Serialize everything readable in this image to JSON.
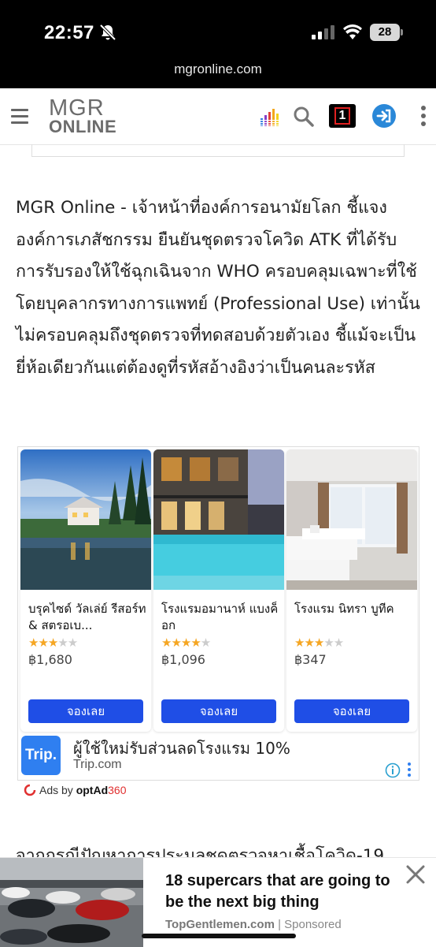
{
  "status_bar": {
    "time": "22:57",
    "battery": "28",
    "url": "mgronline.com"
  },
  "header": {
    "logo_line1": "MGR",
    "logo_line2": "ONLINE",
    "notification_badge": "1"
  },
  "article": {
    "paragraph1": "MGR Online - เจ้าหน้าที่องค์การอนามัยโลก ชี้แจงองค์การเภสัชกรรม ยืนยันชุดตรวจโควิด ATK ที่ได้รับการรับรองให้ใช้ฉุกเฉินจาก WHO ครอบคลุมเฉพาะที่ใช้โดยบุคลากรทางการแพทย์ (Professional Use) เท่านั้น ไม่ครอบคลุมถึงชุดตรวจที่ทดสอบด้วยตัวเอง ชี้แม้จะเป็นยี่ห้อเดียวกันแต่ต้องดูที่รหัสอ้างอิงว่าเป็นคนละรหัส",
    "paragraph2": "จากกรณีปัญหาการประมูลชุดตรวจหาเชื้อโควิด-19"
  },
  "hotel_ad": {
    "hotels": [
      {
        "name": "บรุคไซด์ วัลเล่ย์ รีสอร์ท & สตรอเบ...",
        "stars": 3,
        "price": "฿1,680",
        "button": "จองเลย"
      },
      {
        "name": "โรงแรมอมานาห์ แบงค็อก",
        "stars": 4,
        "price": "฿1,096",
        "button": "จองเลย"
      },
      {
        "name": "โรงแรม นิทรา บูทีค",
        "stars": 3,
        "price": "฿347",
        "button": "จองเลย"
      }
    ],
    "trip_logo": "Trip.",
    "trip_title": "ผู้ใช้ใหม่รับส่วนลดโรงแรม 10%",
    "trip_domain": "Trip.com",
    "ads_by_prefix": "Ads by ",
    "ads_by_brand": "optAd",
    "ads_by_num": "360"
  },
  "bottom_ad": {
    "title": "18 supercars that are going to be the next big thing",
    "source": "TopGentlemen.com",
    "separator": " | ",
    "sponsored": "Sponsored"
  }
}
